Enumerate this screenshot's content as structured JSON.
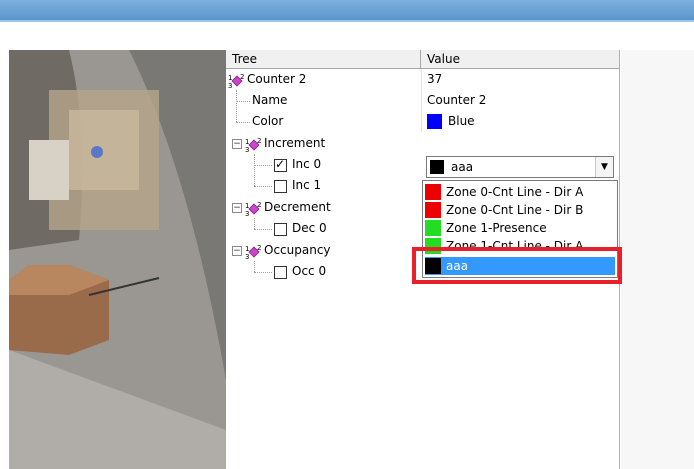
{
  "tree": {
    "headers": {
      "tree": "Tree",
      "value": "Value"
    },
    "counter": {
      "label": "Counter 2",
      "value": "37"
    },
    "name": {
      "label": "Name",
      "value": "Counter 2"
    },
    "color": {
      "label": "Color",
      "value": "Blue",
      "swatch": "#0000ff"
    },
    "increment": {
      "label": "Increment",
      "expander": "−"
    },
    "inc0": {
      "label": "Inc 0",
      "checked": true
    },
    "inc1": {
      "label": "Inc 1",
      "checked": false
    },
    "decrement": {
      "label": "Decrement",
      "expander": "−"
    },
    "dec0": {
      "label": "Dec 0",
      "checked": false
    },
    "occupancy": {
      "label": "Occupancy",
      "expander": "−"
    },
    "occ0": {
      "label": "Occ 0",
      "checked": false
    }
  },
  "combo": {
    "selected": "aaa",
    "selected_color": "#000000",
    "arrow": "▼",
    "options": [
      {
        "label": "Zone 0-Cnt Line - Dir A",
        "color": "#ee0000"
      },
      {
        "label": "Zone 0-Cnt Line - Dir B",
        "color": "#ee0000"
      },
      {
        "label": "Zone 1-Presence",
        "color": "#22dd22"
      },
      {
        "label": "Zone 1-Cnt Line - Dir A",
        "color": "#22dd22"
      },
      {
        "label": "aaa",
        "color": "#000000",
        "selected": true
      }
    ]
  },
  "colors": {
    "highlight": "#e8202a",
    "selection": "#3399ff",
    "group_icon": "#cc44cc"
  }
}
